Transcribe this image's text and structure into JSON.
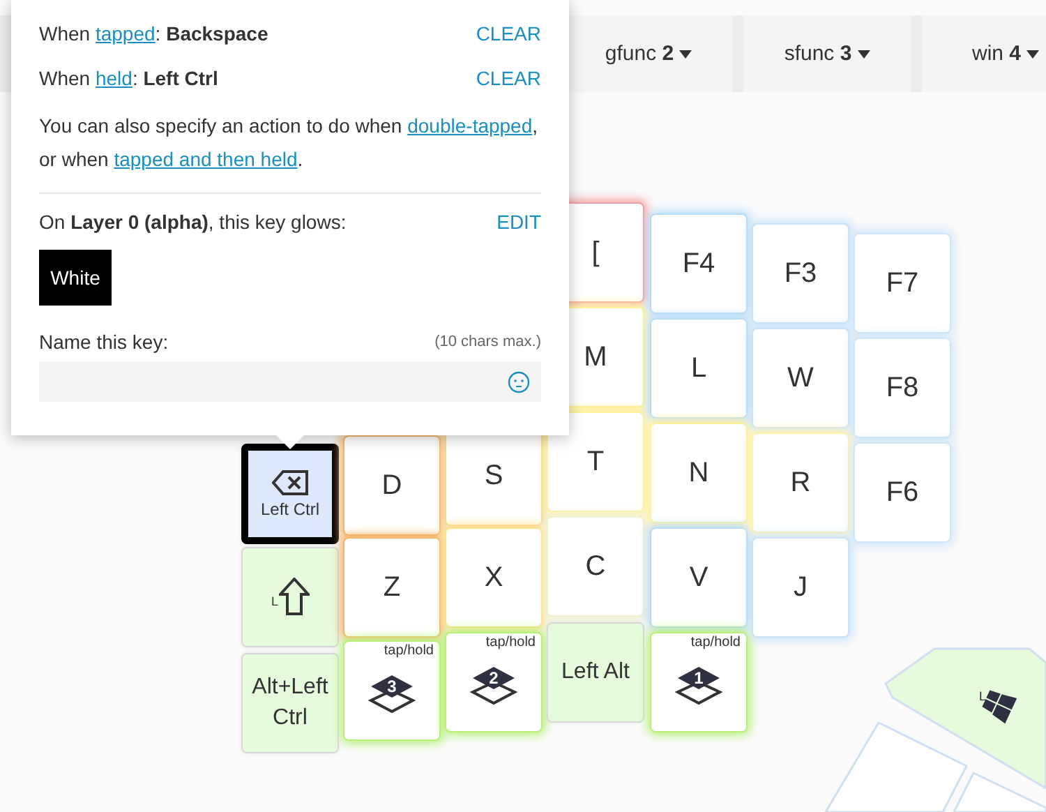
{
  "popup": {
    "tapped": {
      "prefix": "When",
      "link": "tapped",
      "separator": ":",
      "value": "Backspace",
      "action": "CLEAR"
    },
    "held": {
      "prefix": "When",
      "link": "held",
      "separator": ":",
      "value": "Left Ctrl",
      "action": "CLEAR"
    },
    "note": [
      {
        "kind": "text",
        "text": "You can also specify an action to do when "
      },
      {
        "kind": "link",
        "text": "double-tapped"
      },
      {
        "kind": "text",
        "text": ", or when "
      },
      {
        "kind": "link",
        "text": "tapped and then held"
      },
      {
        "kind": "text",
        "text": "."
      }
    ],
    "glow": {
      "text": "On **Layer 0 (alpha)**, this key glows:",
      "action": "EDIT",
      "swatch": "White"
    },
    "name": {
      "label": "Name this key:",
      "hint": "(10 chars max.)"
    }
  },
  "tabs": [
    {
      "label": "gfunc",
      "number": "2"
    },
    {
      "label": "sfunc",
      "number": "3"
    },
    {
      "label": "win",
      "number": "4"
    }
  ],
  "keys": [
    {
      "kind": "backspace",
      "label": "Left Ctrl",
      "selected": true,
      "modifier": false
    },
    {
      "kind": "shift",
      "label": "L",
      "selected": false,
      "modifier": true
    },
    {
      "kind": "char",
      "label": "Alt+Left Ctrl",
      "selected": false,
      "modifier": true,
      "small": true
    },
    {
      "kind": "char",
      "label": "D",
      "selected": false,
      "modifier": false,
      "color": "#f5b46a"
    },
    {
      "kind": "char",
      "label": "Z",
      "selected": false,
      "modifier": false,
      "color": "#f5b46a"
    },
    {
      "kind": "layer",
      "label": "3",
      "top": "tap/hold",
      "selected": false,
      "modifier": false,
      "color": "#b8f07a"
    },
    {
      "kind": "char",
      "label": "S",
      "selected": false,
      "modifier": false,
      "color": "#f5d59a"
    },
    {
      "kind": "char",
      "label": "X",
      "selected": false,
      "modifier": false,
      "color": "#ffe08a"
    },
    {
      "kind": "layer",
      "label": "2",
      "top": "tap/hold",
      "selected": false,
      "modifier": false,
      "color": "#b8f07a"
    },
    {
      "kind": "char",
      "label": "[",
      "selected": false,
      "modifier": false,
      "color": "#f4a0a0"
    },
    {
      "kind": "char",
      "label": "M",
      "selected": false,
      "modifier": false,
      "color": "#fff09a"
    },
    {
      "kind": "char",
      "label": "T",
      "selected": false,
      "modifier": false,
      "color": "#fff09a"
    },
    {
      "kind": "char",
      "label": "C",
      "selected": false,
      "modifier": false,
      "color": "#f0f0d0"
    },
    {
      "kind": "char",
      "label": "Left Alt",
      "selected": false,
      "modifier": true,
      "small": true
    },
    {
      "kind": "char",
      "label": "F4",
      "selected": false,
      "modifier": false,
      "color": "#b8dcf5"
    },
    {
      "kind": "char",
      "label": "L",
      "selected": false,
      "modifier": false,
      "color": "#b8dcf5"
    },
    {
      "kind": "char",
      "label": "N",
      "selected": false,
      "modifier": false,
      "color": "#fff09a"
    },
    {
      "kind": "char",
      "label": "V",
      "selected": false,
      "modifier": false,
      "color": "#b8dcf5"
    },
    {
      "kind": "layer",
      "label": "1",
      "top": "tap/hold",
      "selected": false,
      "modifier": false,
      "color": "#b8f07a"
    },
    {
      "kind": "char",
      "label": "F3",
      "selected": false,
      "modifier": false,
      "color": "#c8e2f8"
    },
    {
      "kind": "char",
      "label": "W",
      "selected": false,
      "modifier": false,
      "color": "#c8e2f8"
    },
    {
      "kind": "char",
      "label": "R",
      "selected": false,
      "modifier": false,
      "color": "#fff0b0"
    },
    {
      "kind": "char",
      "label": "J",
      "selected": false,
      "modifier": false,
      "color": "#c8e2f8"
    },
    {
      "kind": "char",
      "label": "F7",
      "selected": false,
      "modifier": false,
      "color": "#d0e6f8"
    },
    {
      "kind": "char",
      "label": "F8",
      "selected": false,
      "modifier": false,
      "color": "#d0e6f8"
    },
    {
      "kind": "char",
      "label": "F6",
      "selected": false,
      "modifier": false,
      "color": "#d0e6f8"
    }
  ],
  "thumb_keys": [
    {
      "kind": "windows",
      "label": "L",
      "modifier": true
    },
    {
      "kind": "blank",
      "modifier": false
    },
    {
      "kind": "blank",
      "modifier": false
    }
  ]
}
